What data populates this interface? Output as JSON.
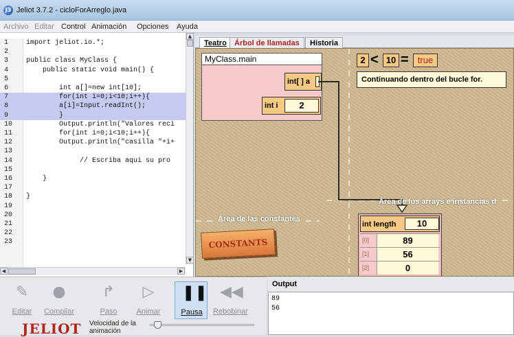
{
  "window": {
    "title": "Jeliot 3.7.2 - cicloForArreglo.java",
    "app_icon": "jeliot-icon"
  },
  "menu": [
    {
      "label": "Archivo",
      "enabled": false
    },
    {
      "label": "Editar",
      "enabled": false
    },
    {
      "label": "Control",
      "enabled": true
    },
    {
      "label": "Animación",
      "enabled": true
    },
    {
      "label": "Opciones",
      "enabled": true
    },
    {
      "label": "Ayuda",
      "enabled": true
    }
  ],
  "editor": {
    "lines": [
      {
        "n": "1",
        "code": "import jeliot.io.*;",
        "hl": false
      },
      {
        "n": "2",
        "code": "",
        "hl": false
      },
      {
        "n": "3",
        "code": "public class MyClass {",
        "hl": false
      },
      {
        "n": "4",
        "code": "    public static void main() {",
        "hl": false
      },
      {
        "n": "5",
        "code": "",
        "hl": false
      },
      {
        "n": "6",
        "code": "        int a[]=new int[10];",
        "hl": false
      },
      {
        "n": "7",
        "code": "        for(int i=0;i<10;i++){",
        "hl": true
      },
      {
        "n": "8",
        "code": "        a[i]=Input.readInt();",
        "hl": true
      },
      {
        "n": "9",
        "code": "        }",
        "hl": true
      },
      {
        "n": "10",
        "code": "        Output.println(\"Valores reci",
        "hl": false
      },
      {
        "n": "11",
        "code": "        for(int i=0;i<10;i++){",
        "hl": false
      },
      {
        "n": "12",
        "code": "        Output.println(\"casilla \"+i+",
        "hl": false
      },
      {
        "n": "13",
        "code": "",
        "hl": false
      },
      {
        "n": "14",
        "code": "             // Escriba aqui su pro",
        "hl": false
      },
      {
        "n": "15",
        "code": "",
        "hl": false
      },
      {
        "n": "16",
        "code": "    }",
        "hl": false
      },
      {
        "n": "17",
        "code": "",
        "hl": false
      },
      {
        "n": "18",
        "code": "}",
        "hl": false
      },
      {
        "n": "19",
        "code": "",
        "hl": false
      },
      {
        "n": "20",
        "code": "",
        "hl": false
      },
      {
        "n": "21",
        "code": "",
        "hl": false
      },
      {
        "n": "22",
        "code": "",
        "hl": false
      },
      {
        "n": "23",
        "code": "",
        "hl": false
      }
    ]
  },
  "tabs": [
    {
      "label": "Teatro",
      "active": true
    },
    {
      "label": "Árbol de llamadas",
      "active": false
    },
    {
      "label": "Historia",
      "active": false
    }
  ],
  "theater": {
    "method_frame": {
      "title": "MyClass.main",
      "array_ref_label": "int[ ] a",
      "var_label": "int i",
      "var_value": "2"
    },
    "expression": {
      "left": "2",
      "op": "<",
      "right": "10",
      "eq": "=",
      "result": "true"
    },
    "message": "Continuando dentro del bucle for.",
    "constants_area_label": "Área de las constantes",
    "constants_button": "CONSTANTS",
    "arrays_area_label": "Área de los arrays e instancias d",
    "array": {
      "length_label": "int length",
      "length_value": "10",
      "cells": [
        {
          "index": "[0]",
          "value": "89"
        },
        {
          "index": "[1]",
          "value": "56"
        },
        {
          "index": "[2]",
          "value": "0"
        }
      ]
    }
  },
  "controls": {
    "buttons": [
      {
        "label": "Editar",
        "icon": "edit-icon",
        "active": false
      },
      {
        "label": "Compilar",
        "icon": "compile-icon",
        "active": false
      },
      {
        "label": "Paso",
        "icon": "step-icon",
        "active": false
      },
      {
        "label": "Animar",
        "icon": "play-icon",
        "active": false
      },
      {
        "label": "Pausa",
        "icon": "pause-icon",
        "active": true
      },
      {
        "label": "Rebobinar",
        "icon": "rewind-icon",
        "active": false
      }
    ],
    "logo": "JELIOT",
    "speed_label_1": "Velocidad de la",
    "speed_label_2": "animación"
  },
  "output": {
    "title": "Output",
    "lines": [
      "89",
      "56"
    ]
  }
}
